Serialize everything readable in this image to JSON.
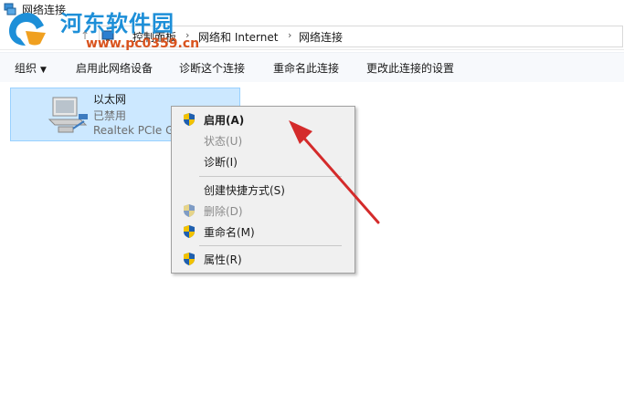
{
  "window": {
    "title": "网络连接"
  },
  "watermark": {
    "title": "河东软件园",
    "url": "www.pc0359.cn"
  },
  "addressbar": {
    "breadcrumbs": [
      "控制面板",
      "网络和 Internet",
      "网络连接"
    ]
  },
  "toolbar": {
    "organize": "组织",
    "enable_device": "启用此网络设备",
    "diagnose": "诊断这个连接",
    "rename": "重命名此连接",
    "change_settings": "更改此连接的设置"
  },
  "adapter": {
    "name": "以太网",
    "status": "已禁用",
    "description": "Realtek PCIe G"
  },
  "context_menu": {
    "items": [
      {
        "label": "启用(A)",
        "shield": true,
        "disabled": false,
        "bold": true
      },
      {
        "label": "状态(U)",
        "shield": false,
        "disabled": true,
        "bold": false
      },
      {
        "label": "诊断(I)",
        "shield": false,
        "disabled": false,
        "bold": false
      },
      {
        "label": "创建快捷方式(S)",
        "shield": false,
        "disabled": false,
        "bold": false
      },
      {
        "label": "删除(D)",
        "shield": true,
        "disabled": true,
        "bold": false
      },
      {
        "label": "重命名(M)",
        "shield": true,
        "disabled": false,
        "bold": false
      },
      {
        "label": "属性(R)",
        "shield": true,
        "disabled": false,
        "bold": false
      }
    ]
  },
  "colors": {
    "selection_bg": "#cce8ff",
    "selection_border": "#99d1ff",
    "annotation_arrow": "#d42b2b",
    "watermark_blue": "#1d8fd8",
    "watermark_orange": "#d9531e"
  }
}
